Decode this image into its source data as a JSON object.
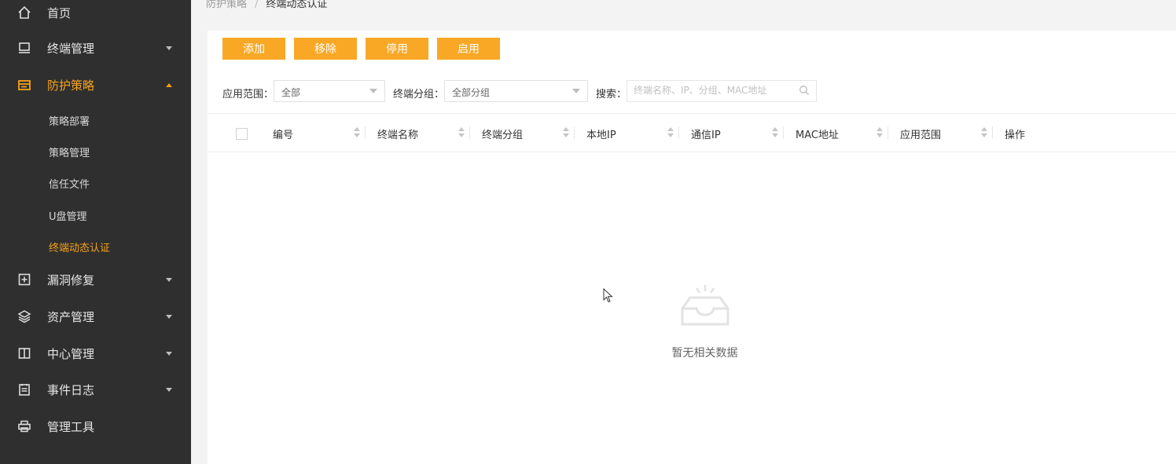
{
  "sidebar": {
    "items": [
      {
        "label": "首页",
        "icon": "home-icon"
      },
      {
        "label": "终端管理",
        "icon": "monitor-icon"
      },
      {
        "label": "防护策略",
        "icon": "shield-card-icon"
      },
      {
        "label": "漏洞修复",
        "icon": "plus-square-icon"
      },
      {
        "label": "资产管理",
        "icon": "layers-icon"
      },
      {
        "label": "中心管理",
        "icon": "book-icon"
      },
      {
        "label": "事件日志",
        "icon": "log-icon"
      },
      {
        "label": "管理工具",
        "icon": "printer-icon"
      }
    ],
    "sub_items": [
      {
        "label": "策略部署"
      },
      {
        "label": "策略管理"
      },
      {
        "label": "信任文件"
      },
      {
        "label": "U盘管理"
      },
      {
        "label": "终端动态认证"
      }
    ],
    "accent_color": "#f7a21b"
  },
  "breadcrumb": {
    "parent": "防护策略",
    "separator": "/",
    "current": "终端动态认证"
  },
  "toolbar": {
    "add_label": "添加",
    "remove_label": "移除",
    "disable_label": "停用",
    "enable_label": "启用",
    "button_color": "#f9a825"
  },
  "filters": {
    "scope_label": "应用范围：",
    "scope_value": "全部",
    "group_label": "终端分组：",
    "group_value": "全部分组",
    "search_label": "搜索：",
    "search_placeholder": "终端名称、IP、分组、MAC地址"
  },
  "table": {
    "columns": [
      "编号",
      "终端名称",
      "终端分组",
      "本地IP",
      "通信IP",
      "MAC地址",
      "应用范围",
      "操作"
    ],
    "empty_text": "暂无相关数据"
  }
}
